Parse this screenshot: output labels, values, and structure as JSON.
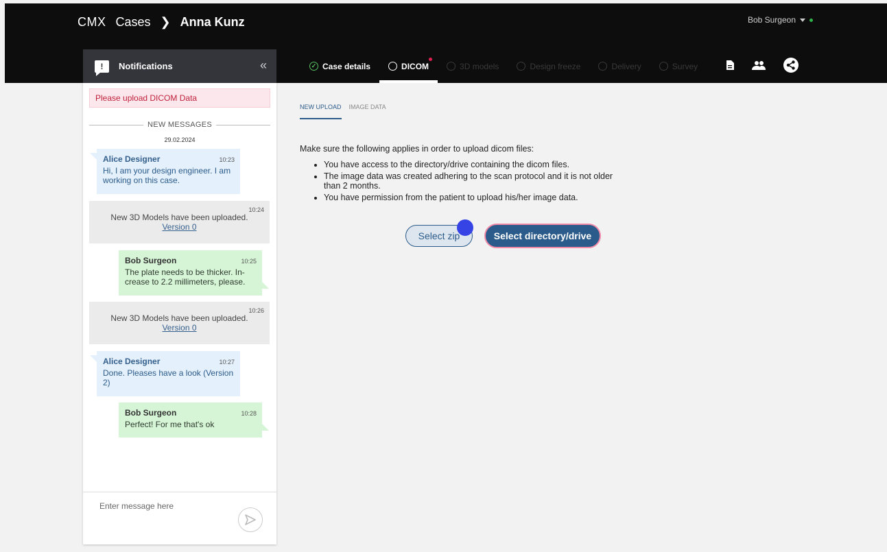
{
  "header": {
    "brand": "CMX",
    "breadcrumb_cases": "Cases",
    "breadcrumb_patient": "Anna Kunz",
    "user_name": "Bob Surgeon",
    "status_color": "#2fb34a"
  },
  "sidebar": {
    "title": "Notifications",
    "alert": "Please upload DICOM Data",
    "divider": "NEW MESSAGES",
    "date": "29.02.2024",
    "messages": [
      {
        "author": "Alice Designer",
        "time": "10:23",
        "text": "Hi, I am your design engineer. I am working on this case."
      },
      {
        "time": "10:24",
        "text": "New 3D Models have been uploaded.",
        "link": "Version 0"
      },
      {
        "author": "Bob Surgeon",
        "time": "10:25",
        "text": "The plate needs to be thicker. In-crease to 2.2 millimeters, please."
      },
      {
        "time": "10:26",
        "text": "New 3D Models have been uploaded.",
        "link": "Version 0"
      },
      {
        "author": "Alice Designer",
        "time": "10:27",
        "text": "Done. Pleases have a look (Version 2)"
      },
      {
        "author": "Bob Surgeon",
        "time": "10:28",
        "text": "Perfect! For me that's ok"
      }
    ],
    "composer_placeholder": "Enter message here"
  },
  "tabs": [
    {
      "label": "Case details",
      "state": "done"
    },
    {
      "label": "DICOM",
      "state": "active"
    },
    {
      "label": "3D models",
      "state": "disabled"
    },
    {
      "label": "Design freeze",
      "state": "disabled"
    },
    {
      "label": "Delivery",
      "state": "disabled"
    },
    {
      "label": "Survey",
      "state": "disabled"
    }
  ],
  "toolbar_icons": [
    "document-icon",
    "people-icon",
    "share-icon"
  ],
  "subtabs": {
    "new_upload": "NEW UPLOAD",
    "image_data": "IMAGE DATA"
  },
  "upload": {
    "intro": "Make sure the following applies in order to upload dicom files:",
    "items": [
      "You have access to the directory/drive containing the dicom files.",
      "The image data was created adhering to the scan protocol and it is not older than 2 months.",
      "You have permission from the patient to upload his/her image data."
    ],
    "select_zip": "Select zip",
    "select_directory": "Select directory/drive"
  }
}
